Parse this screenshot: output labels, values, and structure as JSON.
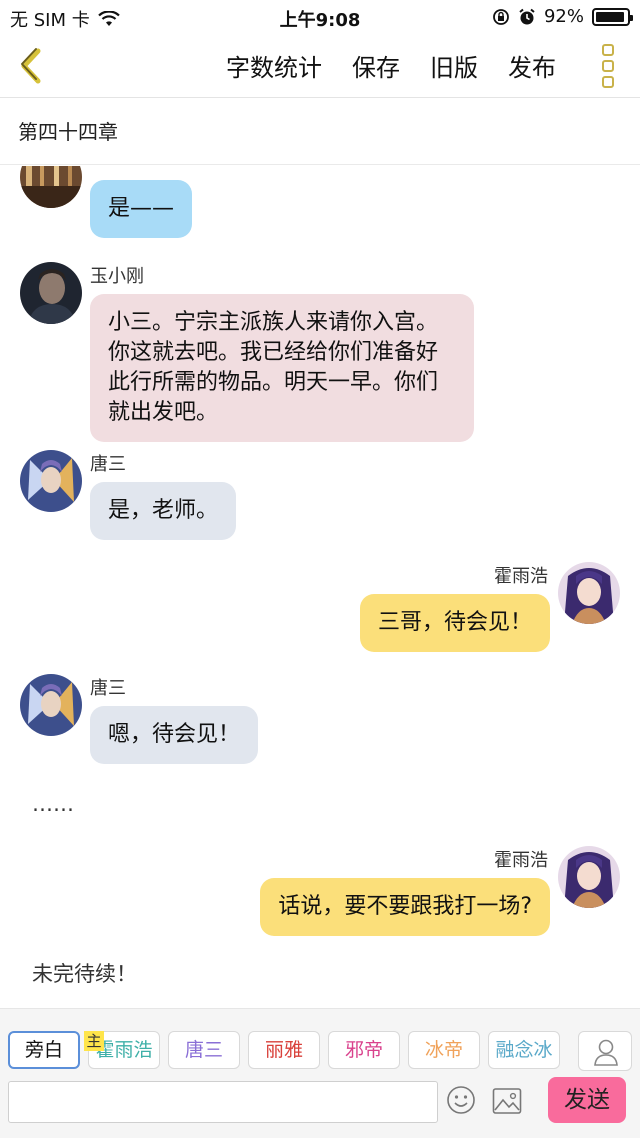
{
  "status_bar": {
    "carrier": "无 SIM 卡",
    "time": "上午9:08",
    "battery_text": "92%",
    "battery_level": 0.92
  },
  "nav": {
    "actions": [
      "字数统计",
      "保存",
      "旧版",
      "发布"
    ]
  },
  "chapter_title": "第四十四章",
  "messages": [
    {
      "sender": "",
      "text": "是——",
      "side": "left",
      "color": "#a8dbf7"
    },
    {
      "sender": "玉小刚",
      "text": "小三。宁宗主派族人来请你入宫。你这就去吧。我已经给你们准备好此行所需的物品。明天一早。你们就出发吧。",
      "side": "left",
      "color": "#f1dde0"
    },
    {
      "sender": "唐三",
      "text": "是，老师。",
      "side": "left",
      "color": "#e1e6ee"
    },
    {
      "sender": "霍雨浩",
      "text": "三哥，待会见！",
      "side": "right",
      "color": "#fbdf7a"
    },
    {
      "sender": "唐三",
      "text": "嗯，待会见！",
      "side": "left",
      "color": "#e1e6ee"
    },
    {
      "sender": "",
      "text": "……",
      "side": "narration"
    },
    {
      "sender": "霍雨浩",
      "text": "话说，要不要跟我打一场?",
      "side": "right",
      "color": "#fbdf7a"
    },
    {
      "sender": "",
      "text": "未完待续！",
      "side": "narration"
    }
  ],
  "roles": {
    "main_tag": "主",
    "items": [
      {
        "label": "旁白",
        "color": "#111111",
        "active": true
      },
      {
        "label": "霍雨浩",
        "color": "#3fb0a8"
      },
      {
        "label": "唐三",
        "color": "#8a6fd6"
      },
      {
        "label": "丽雅",
        "color": "#d9413b"
      },
      {
        "label": "邪帝",
        "color": "#d9418c"
      },
      {
        "label": "冰帝",
        "color": "#f0a25a"
      },
      {
        "label": "融念冰",
        "color": "#5aa9c9"
      }
    ]
  },
  "composer": {
    "placeholder": "",
    "send_label": "发送"
  }
}
